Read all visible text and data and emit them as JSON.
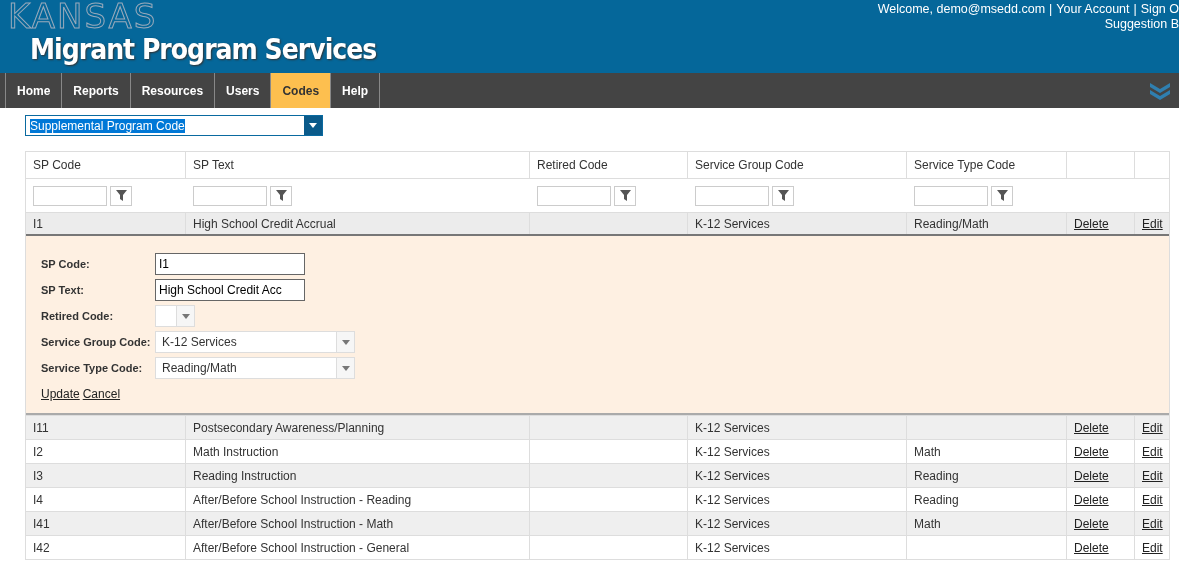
{
  "header": {
    "logo_outline": "KANSAS",
    "title": "Migrant Program Services",
    "user_links": [
      {
        "text": "Welcome, demo@msedd.com"
      },
      {
        "text": "Your Account"
      },
      {
        "text": "Sign O"
      }
    ],
    "separators": [
      "|",
      "|"
    ],
    "suggestion_link": "Suggestion B"
  },
  "nav": [
    {
      "label": "Home",
      "selected": false
    },
    {
      "label": "Reports",
      "selected": false
    },
    {
      "label": "Resources",
      "selected": false
    },
    {
      "label": "Users",
      "selected": false
    },
    {
      "label": "Codes",
      "selected": true
    },
    {
      "label": "Help",
      "selected": false
    }
  ],
  "code_select": {
    "value": "Supplemental Program Code"
  },
  "table": {
    "columns": [
      "SP Code",
      "SP Text",
      "Retired Code",
      "Service Group Code",
      "Service Type Code"
    ],
    "rows": [
      {
        "cells": [
          "I1",
          "High School Credit Accrual",
          "",
          "K-12 Services",
          "Reading/Math"
        ],
        "delete": "Delete",
        "edit": "Edit",
        "expanded": true
      },
      {
        "cells": [
          "I11",
          "Postsecondary Awareness/Planning",
          "",
          "K-12 Services",
          ""
        ],
        "delete": "Delete",
        "edit": "Edit",
        "expanded": false
      },
      {
        "cells": [
          "I2",
          "Math Instruction",
          "",
          "K-12 Services",
          "Math"
        ],
        "delete": "Delete",
        "edit": "Edit",
        "expanded": false
      },
      {
        "cells": [
          "I3",
          "Reading Instruction",
          "",
          "K-12 Services",
          "Reading"
        ],
        "delete": "Delete",
        "edit": "Edit",
        "expanded": false
      },
      {
        "cells": [
          "I4",
          "After/Before School Instruction - Reading",
          "",
          "K-12 Services",
          "Reading"
        ],
        "delete": "Delete",
        "edit": "Edit",
        "expanded": false
      },
      {
        "cells": [
          "I41",
          "After/Before School Instruction - Math",
          "",
          "K-12 Services",
          "Math"
        ],
        "delete": "Delete",
        "edit": "Edit",
        "expanded": false
      },
      {
        "cells": [
          "I42",
          "After/Before School Instruction - General",
          "",
          "K-12 Services",
          ""
        ],
        "delete": "Delete",
        "edit": "Edit",
        "expanded": false
      }
    ]
  },
  "edit_form": {
    "fields": [
      {
        "label": "SP Code:",
        "kind": "text",
        "value": "I1"
      },
      {
        "label": "SP Text:",
        "kind": "text",
        "value": "High School Credit Acc"
      },
      {
        "label": "Retired Code:",
        "kind": "small-select"
      },
      {
        "label": "Service Group Code:",
        "kind": "select",
        "value": "K-12 Services"
      },
      {
        "label": "Service Type Code:",
        "kind": "select",
        "value": "Reading/Math"
      }
    ],
    "actions": [
      "Update",
      "Cancel"
    ]
  }
}
